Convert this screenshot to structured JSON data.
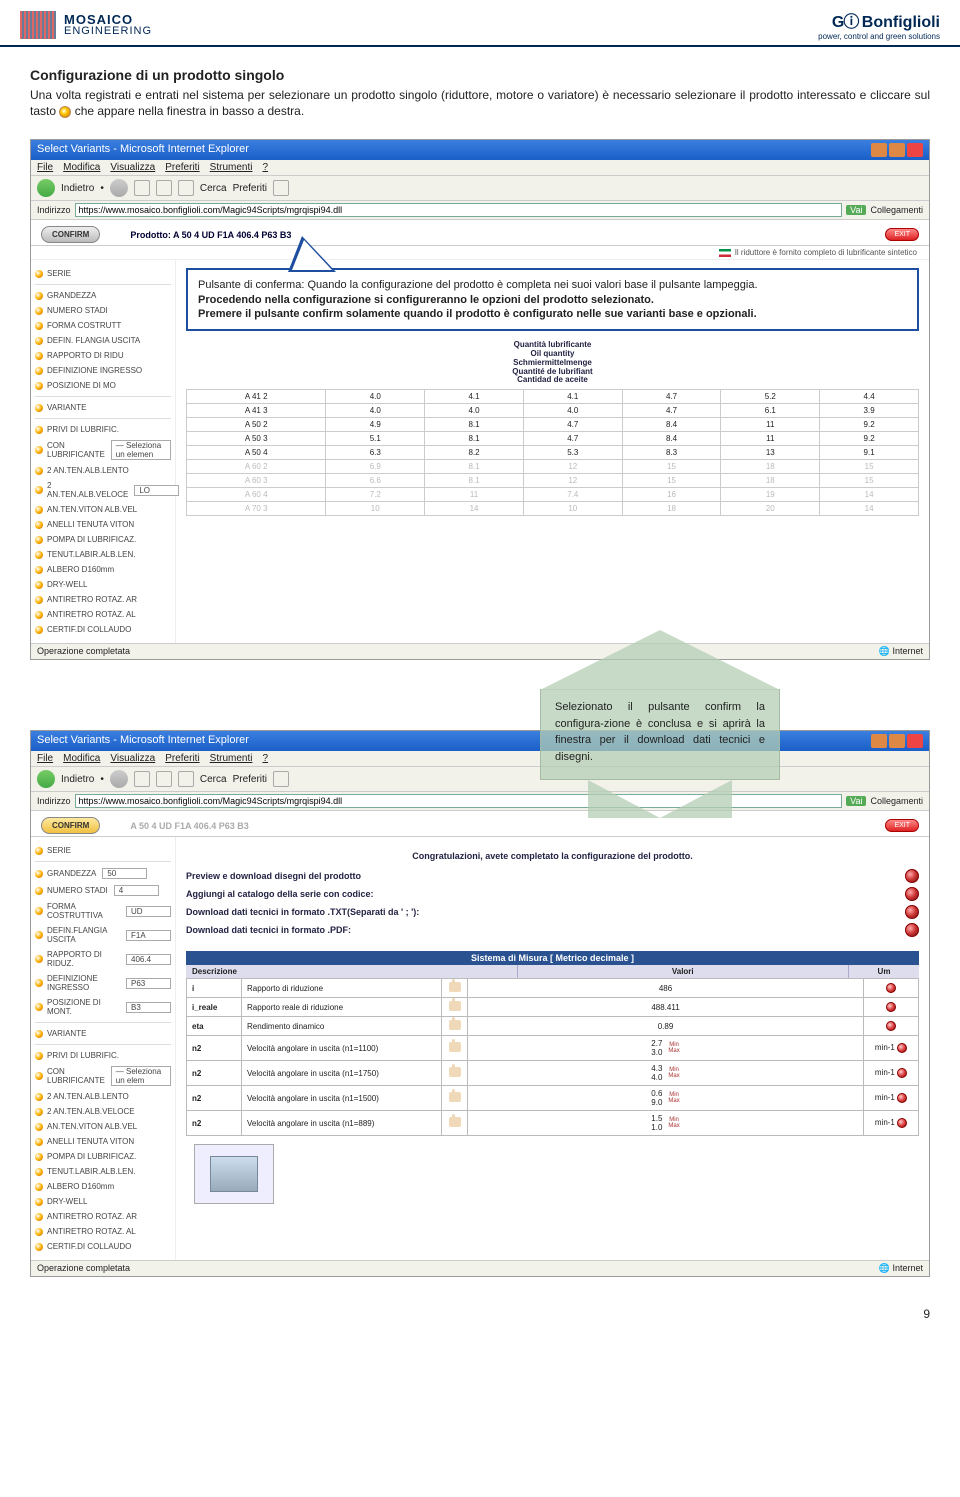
{
  "header": {
    "left_brand_line1": "MOSAICO",
    "left_brand_line2": "ENGINEERING",
    "right_brand": "Bonfiglioli",
    "right_tag": "power, control and green solutions"
  },
  "intro": {
    "title": "Configurazione di un prodotto singolo",
    "p1_a": "Una volta registrati e entrati nel sistema per selezionare un prodotto singolo (riduttore, motore o variatore) è necessario selezionare il prodotto interessato e cliccare sul tasto ",
    "p1_b": " che appare nella finestra in basso a destra."
  },
  "ie": {
    "title": "Select Variants - Microsoft Internet Explorer",
    "menu": [
      "File",
      "Modifica",
      "Visualizza",
      "Preferiti",
      "Strumenti",
      "?"
    ],
    "back": "Indietro",
    "search": "Cerca",
    "fav": "Preferiti",
    "addr_label": "Indirizzo",
    "addr_val": "https://www.mosaico.bonfiglioli.com/Magic94Scripts/mgrqispi94.dll",
    "go": "Vai",
    "links": "Collegamenti",
    "status_left": "Operazione completata",
    "status_right": "Internet"
  },
  "app": {
    "confirm": "CONFIRM",
    "prod_prefix": "Prodotto:",
    "prod_code": "A 50 4 UD F1A 406.4 P63 B3",
    "prod_code_dim": "A 50 4 UD F1A 406.4 P63 B3",
    "exit": "EXIT",
    "flag_text": "Il riduttore è fornito completo di lubrificante sintetico",
    "congrat": "Congratulazioni, avete completato la configurazione del prodotto.",
    "dl_preview": "Preview e download disegni del prodotto",
    "dl_add_cat": "Aggiungi al catalogo della serie con codice:",
    "dl_txt": "Download dati tecnici in formato .TXT(Separati da ' ; '):",
    "dl_pdf": "Download dati tecnici in formato .PDF:",
    "sys_header": "Sistema di Misura [ Metrico decimale ]",
    "col_desc": "Descrizione",
    "col_val": "Valori",
    "col_um": "Um"
  },
  "sidebar_items": [
    "SERIE",
    "GRANDEZZA",
    "NUMERO STADI",
    "FORMA COSTRUTT",
    "DEFIN. FLANGIA USCITA",
    "RAPPORTO DI RIDU",
    "DEFINIZIONE INGRESSO",
    "POSIZIONE DI MO",
    "VARIANTE",
    "PRIVI DI LUBRIFIC.",
    "CON LUBRIFICANTE",
    "2 AN.TEN.ALB.LENTO",
    "2 AN.TEN.ALB.VELOCE",
    "AN.TEN.VITON ALB.VEL",
    "ANELLI TENUTA VITON",
    "POMPA DI LUBRIFICAZ.",
    "TENUT.LABIR.ALB.LEN.",
    "ALBERO D160mm",
    "DRY-WELL",
    "ANTIRETRO ROTAZ. AR",
    "ANTIRETRO ROTAZ. AL",
    "CERTIF.DI COLLAUDO"
  ],
  "sidebar2_items": [
    "SERIE",
    "GRANDEZZA",
    "NUMERO STADI",
    "FORMA COSTRUTTIVA",
    "DEFIN.FLANGIA USCITA",
    "RAPPORTO DI RIDUZ.",
    "DEFINIZIONE INGRESSO",
    "POSIZIONE DI MONT.",
    "VARIANTE",
    "PRIVI DI LUBRIFIC.",
    "CON LUBRIFICANTE",
    "2 AN.TEN.ALB.LENTO",
    "2 AN.TEN.ALB.VELOCE",
    "AN.TEN.VITON ALB.VEL",
    "ANELLI TENUTA VITON",
    "POMPA DI LUBRIFICAZ.",
    "TENUT.LABIR.ALB.LEN.",
    "ALBERO D160mm",
    "DRY-WELL",
    "ANTIRETRO ROTAZ. AR",
    "ANTIRETRO ROTAZ. AL",
    "CERTIF.DI COLLAUDO"
  ],
  "sidebar2_vals": {
    "1": "50",
    "2": "4",
    "3": "UD",
    "4": "F1A",
    "5": "406.4",
    "6": "P63",
    "7": "B3",
    "10": "— Seleziona un elem"
  },
  "sel_opt": "— Seleziona un elemen",
  "lo_val": "LO",
  "oil_labels": [
    "Quantità lubrificante",
    "Oil quantity",
    "Schmiermittelmenge",
    "Quantité de lubrifiant",
    "Cantidad de aceite"
  ],
  "table1": {
    "rows": [
      {
        "c": [
          "A 41 2",
          "4.0",
          "4.1",
          "4.1",
          "4.7",
          "5.2",
          "4.4"
        ],
        "dim": false
      },
      {
        "c": [
          "A 41 3",
          "4.0",
          "4.0",
          "4.0",
          "4.7",
          "6.1",
          "3.9"
        ],
        "dim": false
      },
      {
        "c": [
          "A 50 2",
          "4.9",
          "8.1",
          "4.7",
          "8.4",
          "11",
          "9.2"
        ],
        "dim": false
      },
      {
        "c": [
          "A 50 3",
          "5.1",
          "8.1",
          "4.7",
          "8.4",
          "11",
          "9.2"
        ],
        "dim": false
      },
      {
        "c": [
          "A 50 4",
          "6.3",
          "8.2",
          "5.3",
          "8.3",
          "13",
          "9.1"
        ],
        "dim": false
      },
      {
        "c": [
          "A 60 2",
          "6.9",
          "8.1",
          "12",
          "15",
          "18",
          "15"
        ],
        "dim": true
      },
      {
        "c": [
          "A 60 3",
          "6.6",
          "8.1",
          "12",
          "15",
          "18",
          "15"
        ],
        "dim": true
      },
      {
        "c": [
          "A 60 4",
          "7.2",
          "11",
          "7.4",
          "16",
          "19",
          "14"
        ],
        "dim": true
      },
      {
        "c": [
          "A 70 3",
          "10",
          "14",
          "10",
          "18",
          "20",
          "14"
        ],
        "dim": true
      }
    ]
  },
  "callout": {
    "l1": "Pulsante di conferma: Quando la configurazione del prodotto è completa nei suoi valori base il pulsante lampeggia.",
    "l2": "Procedendo nella configurazione si configureranno le opzioni del prodotto selezionato.",
    "l3": "Premere il pulsante confirm solamente quando il prodotto è configurato nelle sue varianti base e opzionali."
  },
  "arrow_text": "Selezionato il pulsante confirm la configura-zione è conclusa e si aprirà la finestra per il download dati tecnici e disegni.",
  "spec_rows": [
    {
      "k": "i",
      "d": "Rapporto di riduzione",
      "v": "486",
      "u": ""
    },
    {
      "k": "i_reale",
      "d": "Rapporto reale di riduzione",
      "v": "488.411",
      "u": ""
    },
    {
      "k": "eta",
      "d": "Rendimento dinamico",
      "v": "0.89",
      "u": ""
    },
    {
      "k": "n2",
      "d": "Velocità angolare in uscita (n1=1100)",
      "v": "2.7\n3.0",
      "u": "min-1",
      "mm": true
    },
    {
      "k": "n2",
      "d": "Velocità angolare in uscita (n1=1750)",
      "v": "4.3\n4.0",
      "u": "min-1",
      "mm": true
    },
    {
      "k": "n2",
      "d": "Velocità angolare in uscita (n1=1500)",
      "v": "0.6\n9.0",
      "u": "min-1",
      "mm": true
    },
    {
      "k": "n2",
      "d": "Velocità angolare in uscita (n1=889)",
      "v": "1.5\n1.0",
      "u": "min-1",
      "mm": true
    }
  ],
  "page_num": "9"
}
